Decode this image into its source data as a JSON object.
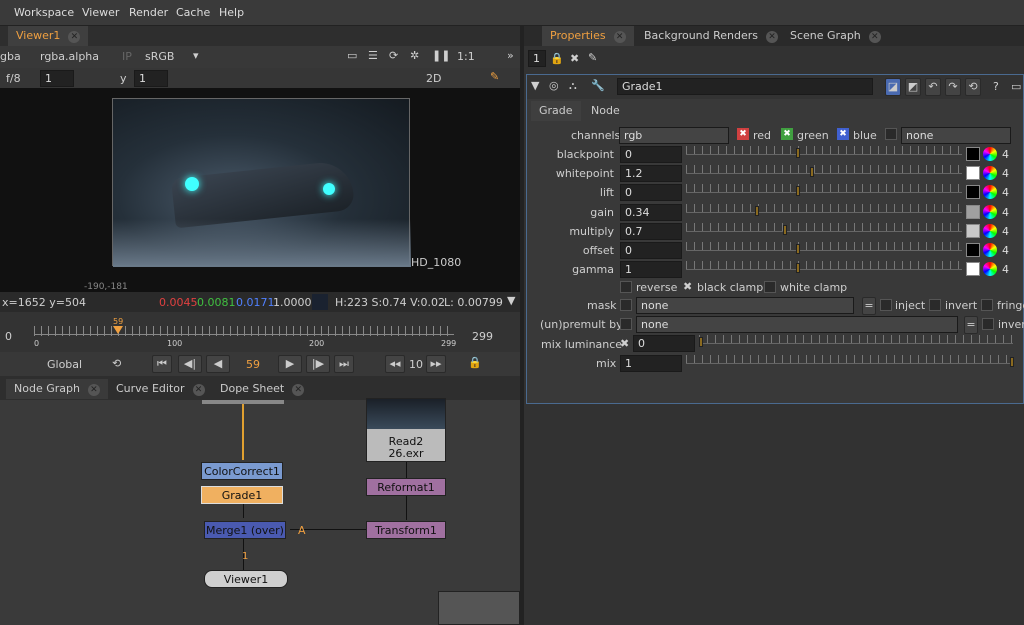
{
  "menu": [
    "Workspace",
    "Viewer",
    "Render",
    "Cache",
    "Help"
  ],
  "viewer": {
    "tab": "Viewer1",
    "channel1": "gba",
    "channel2": "rgba.alpha",
    "ip": "IP",
    "colorspace": "sRGB",
    "ratio": "1:1",
    "fstop": "f/8",
    "frame_field": "1",
    "y_label": "y",
    "y_field": "1",
    "mode2d": "2D",
    "hd_label": "HD_1080",
    "coord": "-190,-181",
    "status_xy": "x=1652 y=504",
    "r": "0.0045",
    "g": "0.0081",
    "b": "0.0171",
    "a": "1.0000",
    "hsv": "H:223 S:0.74 V:0.02",
    "lum": "L: 0.00799"
  },
  "timeline": {
    "start": "0",
    "end": "299",
    "current": "59",
    "ticks": [
      "0",
      "100",
      "200",
      "299"
    ],
    "global": "Global",
    "frame": "59",
    "step": "10"
  },
  "node_tabs": [
    "Node Graph",
    "Curve Editor",
    "Dope Sheet"
  ],
  "nodes": {
    "cc": "ColorCorrect1",
    "grade": "Grade1",
    "merge": "Merge1 (over)",
    "viewer": "Viewer1",
    "read": "Read2",
    "read_file": "26.exr",
    "reformat": "Reformat1",
    "transform": "Transform1",
    "a_label": "A",
    "one_label": "1"
  },
  "props": {
    "tabs": [
      "Properties",
      "Background Renders",
      "Scene Graph"
    ],
    "count": "1",
    "node_name": "Grade1",
    "subtabs": [
      "Grade",
      "Node"
    ],
    "channels_label": "channels",
    "channels_value": "rgb",
    "red": "red",
    "green": "green",
    "blue": "blue",
    "none": "none",
    "knobs": [
      {
        "label": "blackpoint",
        "value": "0",
        "swatch": "#000000"
      },
      {
        "label": "whitepoint",
        "value": "1.2",
        "swatch": "#ffffff"
      },
      {
        "label": "lift",
        "value": "0",
        "swatch": "#000000"
      },
      {
        "label": "gain",
        "value": "0.34",
        "swatch": "#a0a0a0"
      },
      {
        "label": "multiply",
        "value": "0.7",
        "swatch": "#c8c8c8"
      },
      {
        "label": "offset",
        "value": "0",
        "swatch": "#000000"
      },
      {
        "label": "gamma",
        "value": "1",
        "swatch": "#ffffff"
      }
    ],
    "knob_count": "4",
    "reverse": "reverse",
    "black_clamp": "black clamp",
    "white_clamp": "white clamp",
    "mask": "mask",
    "mask_value": "none",
    "inject": "inject",
    "invert": "invert",
    "fringe": "fringe",
    "premult": "(un)premult by",
    "premult_value": "none",
    "premult_invert": "invert",
    "mix_lum": "mix luminance",
    "mix_lum_value": "0",
    "mix": "mix",
    "mix_value": "1"
  }
}
